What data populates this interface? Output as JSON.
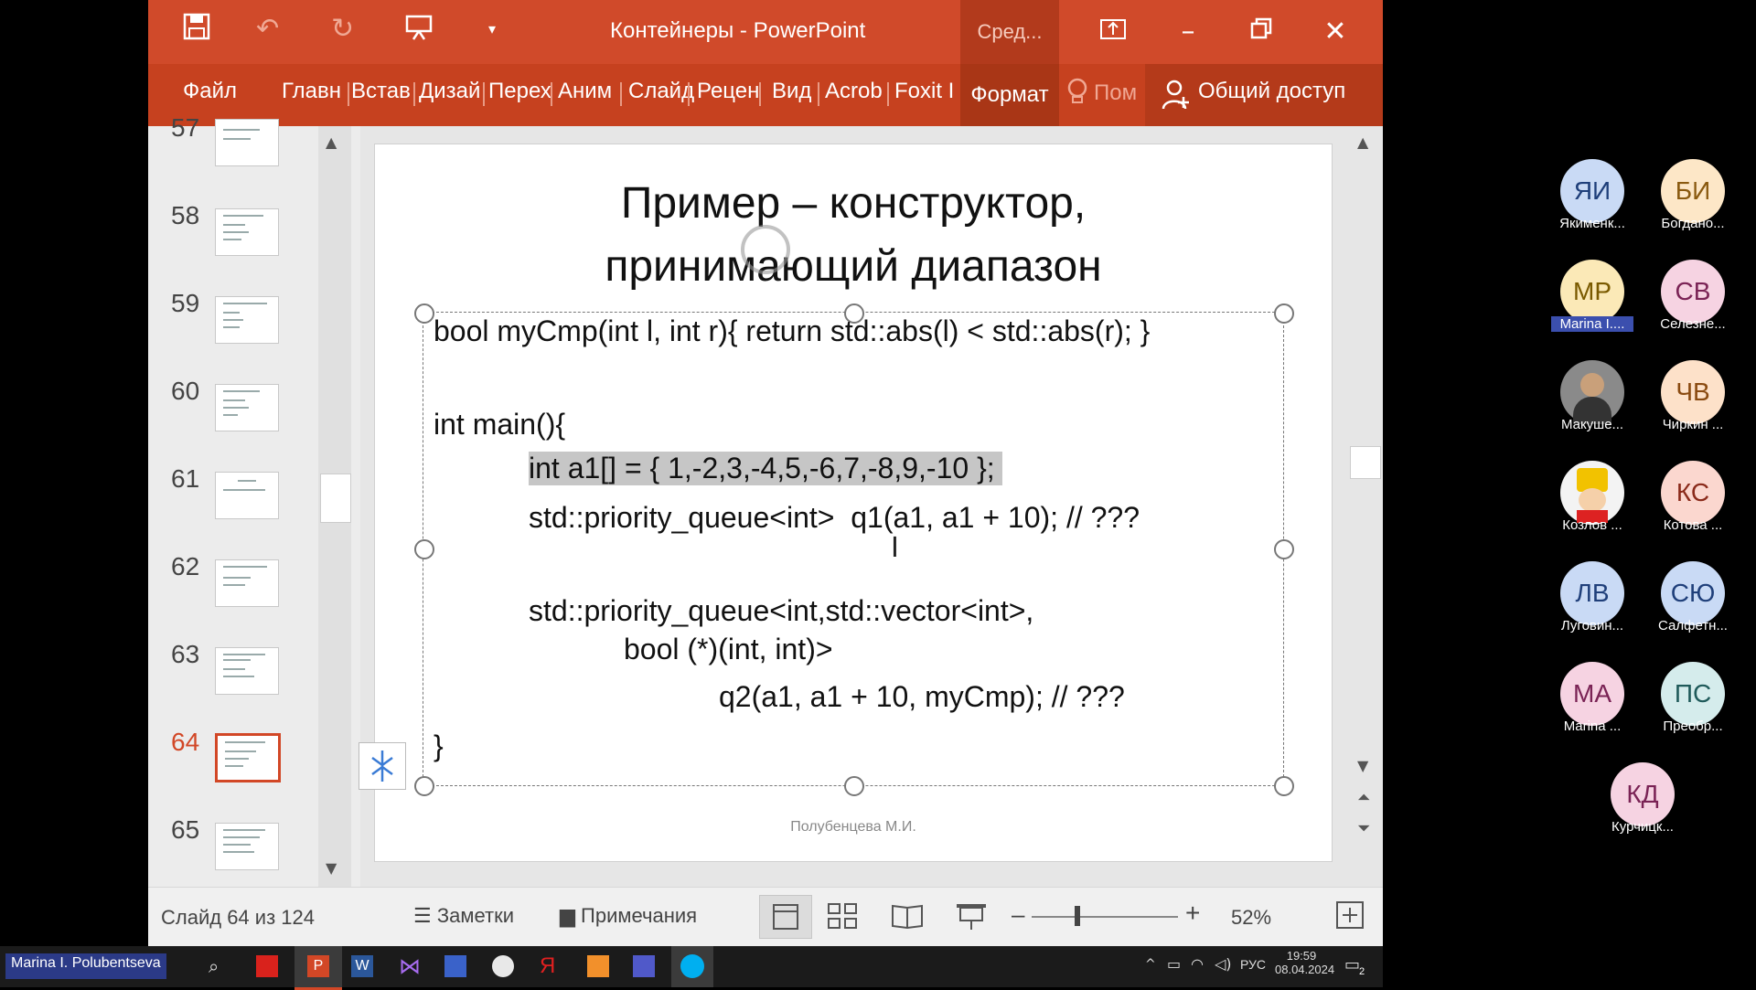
{
  "window": {
    "title": "Контейнеры - PowerPoint",
    "context_tab": "Сред...",
    "share_label": "Общий доступ",
    "tell_me": "Пом"
  },
  "ribbon_tabs": [
    "Файл",
    "Главн",
    "Встав",
    "Дизай",
    "Перех",
    "Аним",
    "Слайд",
    "Рецен",
    "Вид",
    "Acrob",
    "Foxit I",
    "Формат"
  ],
  "thumbnails": [
    {
      "num": "57"
    },
    {
      "num": "58"
    },
    {
      "num": "59"
    },
    {
      "num": "60"
    },
    {
      "num": "61"
    },
    {
      "num": "62"
    },
    {
      "num": "63"
    },
    {
      "num": "64"
    },
    {
      "num": "65"
    }
  ],
  "slide": {
    "title_line1": "Пример – конструктор,",
    "title_line2": "принимающий диапазон",
    "code": {
      "l1": "bool myCmp(int l, int r){ return std::abs(l) < std::abs(r); }",
      "l2": "int main(){",
      "l3": "int a1[] = { 1,-2,3,-4,5,-6,7,-8,9,-10 };",
      "l4": "std::priority_queue<int>  q1(a1, a1 + 10); // ???",
      "l5": "std::priority_queue<int,std::vector<int>,",
      "l6": "bool (*)(int, int)>",
      "l7": "q2(a1, a1 + 10, myCmp); // ???",
      "l8": "}"
    },
    "author": "Полубенцева М.И."
  },
  "status": {
    "slide_info": "Слайд 64 из 124",
    "notes": "Заметки",
    "comments": "Примечания",
    "zoom": "52%"
  },
  "taskbar": {
    "user": "Marina I. Polubentseva",
    "time": "19:59",
    "date": "08.04.2024",
    "lang": "РУС",
    "notif_count": "2"
  },
  "participants": [
    {
      "initials": "ЯИ",
      "name": "Якименк...",
      "bg": "#c9daf5",
      "fg": "#1f3f7a"
    },
    {
      "initials": "БИ",
      "name": "Богдано...",
      "bg": "#fde7c7",
      "fg": "#8a5a10"
    },
    {
      "initials": "МР",
      "name": "Marina I....",
      "bg": "#fbe9b7",
      "fg": "#7a5a00"
    },
    {
      "initials": "СВ",
      "name": "Селезне...",
      "bg": "#f6d3e2",
      "fg": "#7a2355"
    },
    {
      "initials": "",
      "name": "Макуше...",
      "bg": "#888888",
      "fg": "#ffffff"
    },
    {
      "initials": "ЧВ",
      "name": "Чиркин ...",
      "bg": "#fde1c9",
      "fg": "#8a4a10"
    },
    {
      "initials": "",
      "name": "Козлов ...",
      "bg": "#f3f3f3",
      "fg": "#333333"
    },
    {
      "initials": "КС",
      "name": "Котова ...",
      "bg": "#fbd7cf",
      "fg": "#8a2a1a"
    },
    {
      "initials": "ЛВ",
      "name": "Луговин...",
      "bg": "#c9daf5",
      "fg": "#1f3f7a"
    },
    {
      "initials": "СЮ",
      "name": "Салфетн...",
      "bg": "#c9daf5",
      "fg": "#1f3f7a"
    },
    {
      "initials": "МА",
      "name": "Marina ...",
      "bg": "#f6d3e2",
      "fg": "#7a2355"
    },
    {
      "initials": "ПС",
      "name": "Преобр...",
      "bg": "#d5ecec",
      "fg": "#1f5a5a"
    },
    {
      "initials": "КД",
      "name": "Курчицк...",
      "bg": "#f6d3e2",
      "fg": "#7a2355"
    }
  ]
}
